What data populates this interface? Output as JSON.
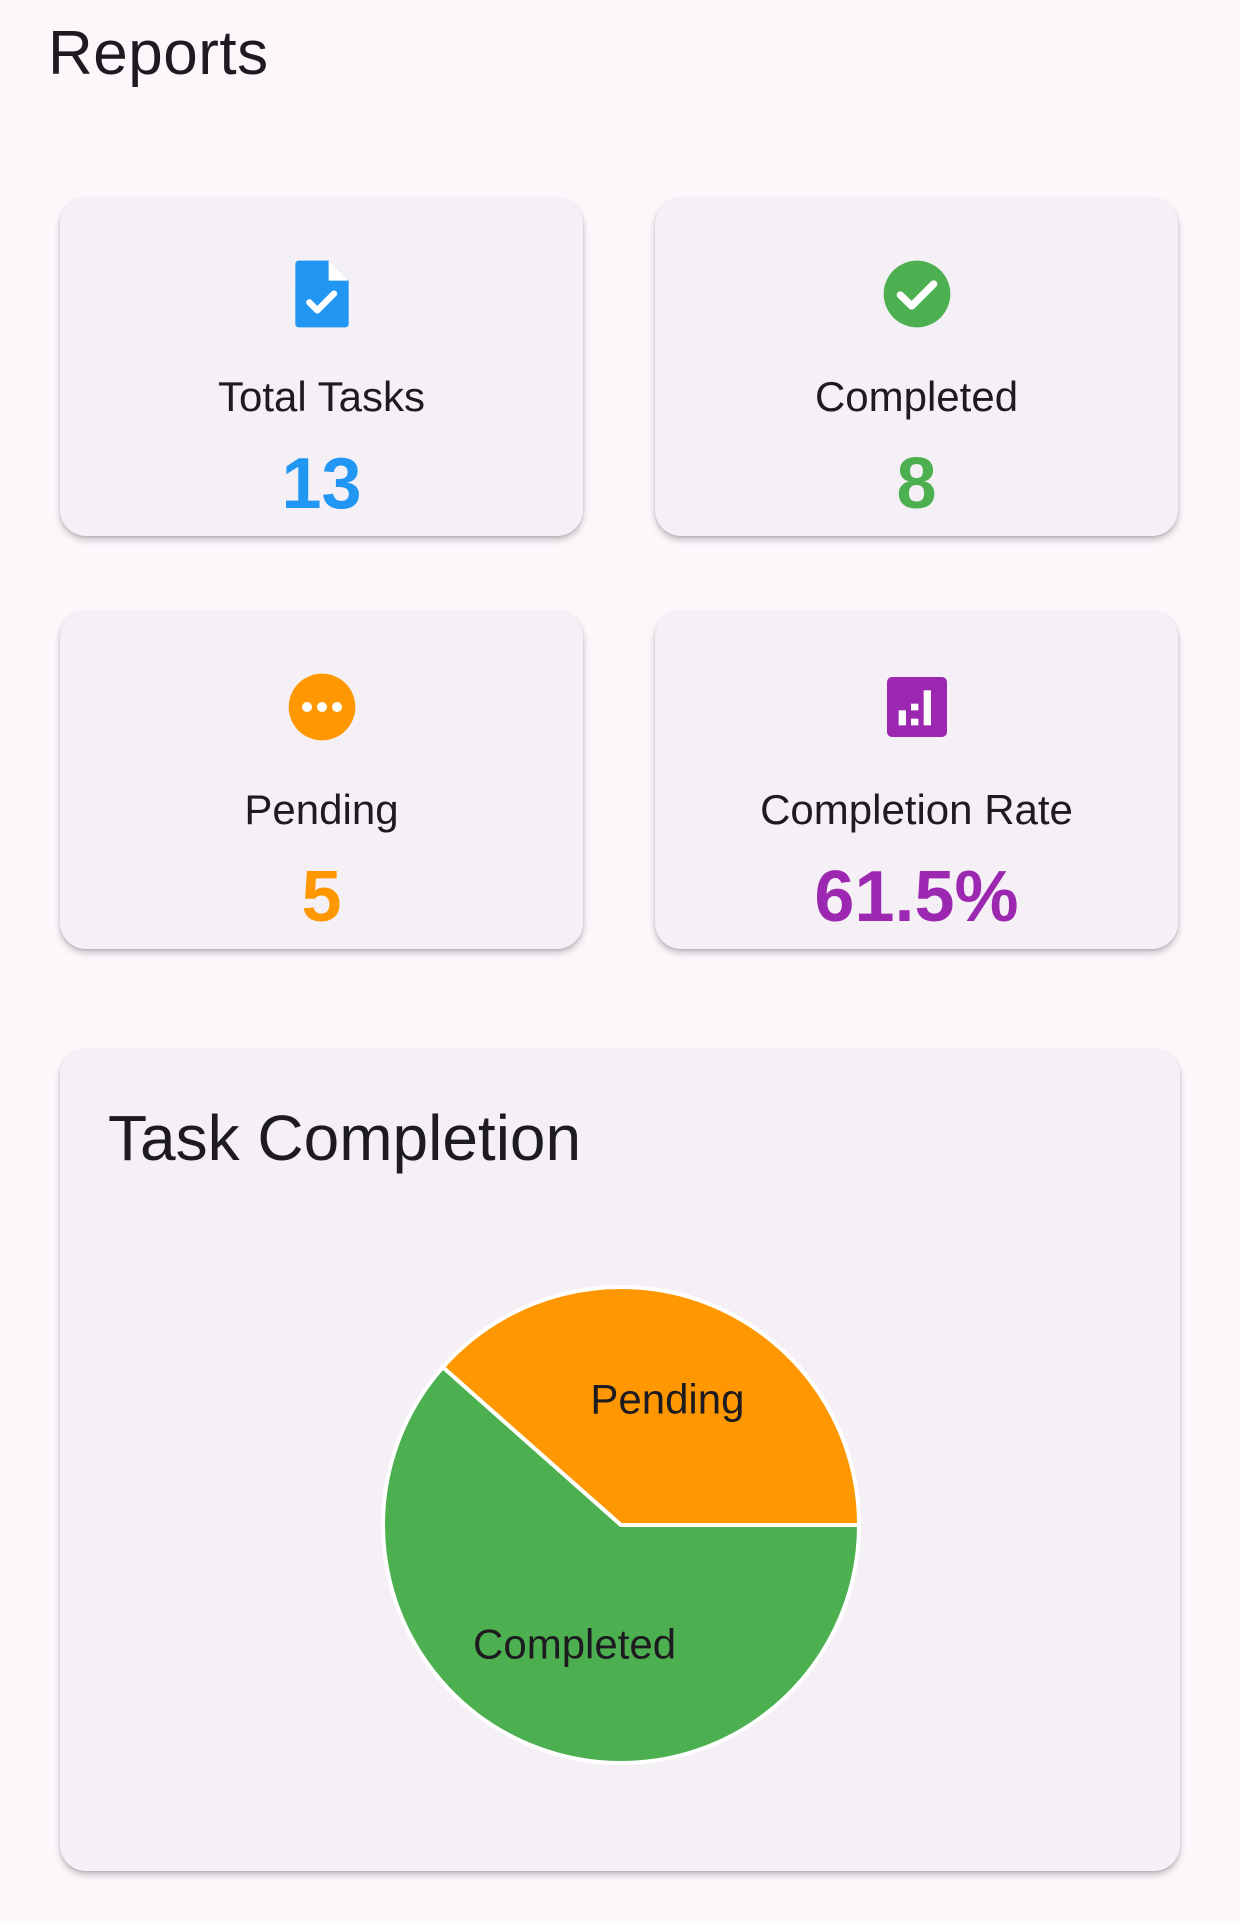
{
  "header": {
    "title": "Reports"
  },
  "stats": [
    {
      "label": "Total Tasks",
      "value": "13",
      "color": "#2196f3",
      "icon": "task-document-icon"
    },
    {
      "label": "Completed",
      "value": "8",
      "color": "#4caf50",
      "icon": "check-circle-icon"
    },
    {
      "label": "Pending",
      "value": "5",
      "color": "#ff9800",
      "icon": "more-horiz-circle-icon"
    },
    {
      "label": "Completion Rate",
      "value": "61.5%",
      "color": "#9c27b0",
      "icon": "bar-chart-icon"
    }
  ],
  "chart_card": {
    "title": "Task Completion"
  },
  "chart_data": {
    "type": "pie",
    "title": "Task Completion",
    "categories": [
      "Completed",
      "Pending"
    ],
    "values": [
      8,
      5
    ],
    "colors": [
      "#4caf50",
      "#ff9800"
    ],
    "legend": "none"
  }
}
